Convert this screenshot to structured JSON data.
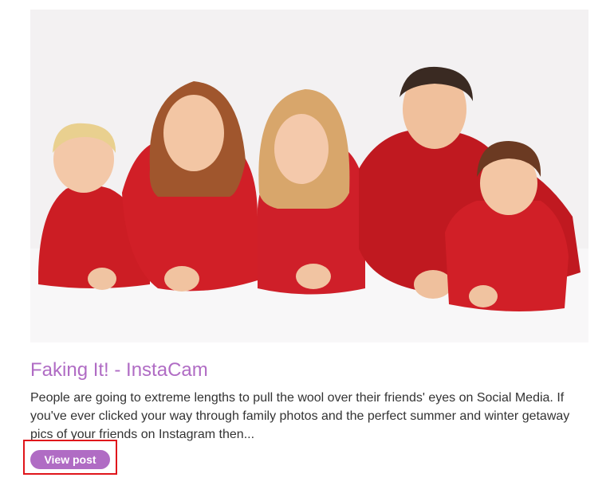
{
  "post": {
    "title": "Faking It! - InstaCam",
    "excerpt": "People are going to extreme lengths to pull the wool over their friends' eyes on Social Media. If you've ever clicked your way through family photos and the perfect summer and winter getaway pics of your friends on Instagram then...",
    "button_label": "View post",
    "image_icon": "family-photo-image"
  },
  "colors": {
    "accent": "#b06cc4",
    "highlight_border": "#e0151b",
    "text": "#333333"
  }
}
